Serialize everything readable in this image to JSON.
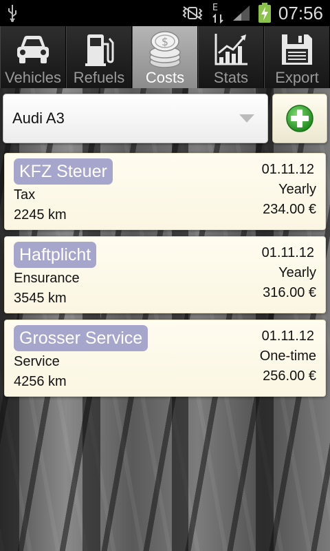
{
  "status_bar": {
    "time": "07:56",
    "network_type": "E",
    "icons": [
      "usb-icon",
      "vibrate-icon",
      "data-transfer-icon",
      "signal-icon",
      "battery-charging-icon"
    ]
  },
  "tabs": [
    {
      "label": "Vehicles",
      "icon": "car-icon",
      "active": false
    },
    {
      "label": "Refuels",
      "icon": "fuel-pump-icon",
      "active": false
    },
    {
      "label": "Costs",
      "icon": "coins-icon",
      "active": true
    },
    {
      "label": "Stats",
      "icon": "chart-icon",
      "active": false
    },
    {
      "label": "Export",
      "icon": "floppy-disk-icon",
      "active": false
    }
  ],
  "vehicle_selector": {
    "selected": "Audi A3"
  },
  "add_button": {
    "icon": "add-icon",
    "color": "#2e9e2e"
  },
  "costs": [
    {
      "title": "KFZ Steuer",
      "category": "Tax",
      "mileage": "2245 km",
      "date": "01.11.12",
      "frequency": "Yearly",
      "amount": "234.00 €"
    },
    {
      "title": "Haftplicht",
      "category": "Ensurance",
      "mileage": "3545 km",
      "date": "01.11.12",
      "frequency": "Yearly",
      "amount": "316.00 €"
    },
    {
      "title": "Grosser Service",
      "category": "Service",
      "mileage": "4256 km",
      "date": "01.11.12",
      "frequency": "One-time",
      "amount": "256.00 €"
    }
  ],
  "colors": {
    "title_badge": "#a6a6cc",
    "card_background": "#fffcf0",
    "tab_active": "#a0a0a0",
    "tab_inactive": "#222222"
  }
}
